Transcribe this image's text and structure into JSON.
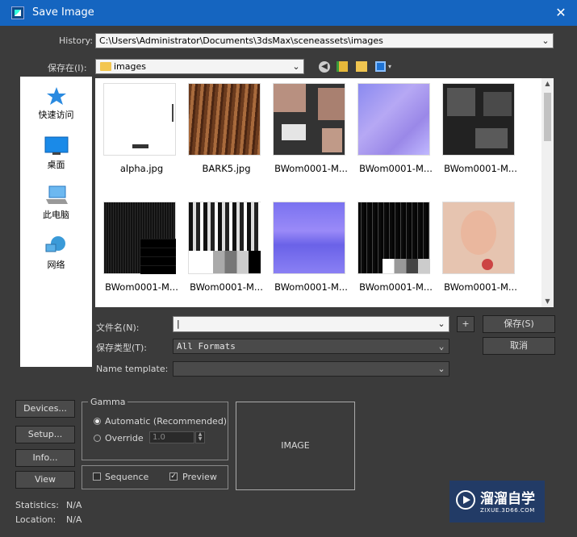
{
  "window": {
    "title": "Save Image",
    "close_glyph": "✕"
  },
  "history": {
    "label": "History:",
    "value": "C:\\Users\\Administrator\\Documents\\3dsMax\\sceneassets\\images"
  },
  "save_in": {
    "label": "保存在(I):",
    "value": "images"
  },
  "places": [
    {
      "label": "快速访问",
      "icon": "star-icon"
    },
    {
      "label": "桌面",
      "icon": "desktop-icon"
    },
    {
      "label": "此电脑",
      "icon": "computer-icon"
    },
    {
      "label": "网络",
      "icon": "network-icon"
    }
  ],
  "files": [
    {
      "name": "alpha.jpg"
    },
    {
      "name": "BARK5.jpg"
    },
    {
      "name": "BWom0001-M..."
    },
    {
      "name": "BWom0001-M..."
    },
    {
      "name": "BWom0001-M..."
    },
    {
      "name": "BWom0001-M..."
    },
    {
      "name": "BWom0001-M..."
    },
    {
      "name": "BWom0001-M..."
    },
    {
      "name": "BWom0001-M..."
    },
    {
      "name": "BWom0001-M..."
    }
  ],
  "filename": {
    "label": "文件名(N):",
    "value": ""
  },
  "save_type": {
    "label": "保存类型(T):",
    "value": "All Formats"
  },
  "name_template": {
    "label": "Name template:",
    "value": ""
  },
  "buttons": {
    "save": "保存(S)",
    "cancel": "取消",
    "plus": "+",
    "devices": "Devices...",
    "setup": "Setup...",
    "info": "Info...",
    "view": "View"
  },
  "gamma": {
    "title": "Gamma",
    "automatic": "Automatic (Recommended)",
    "override": "Override",
    "override_value": "1.0"
  },
  "options": {
    "sequence": "Sequence",
    "preview": "Preview"
  },
  "preview": {
    "label": "IMAGE"
  },
  "stats": {
    "statistics_label": "Statistics:",
    "statistics_value": "N/A",
    "location_label": "Location:",
    "location_value": "N/A"
  },
  "watermark": {
    "title": "溜溜自学",
    "url": "ZIXUE.3D66.COM"
  }
}
